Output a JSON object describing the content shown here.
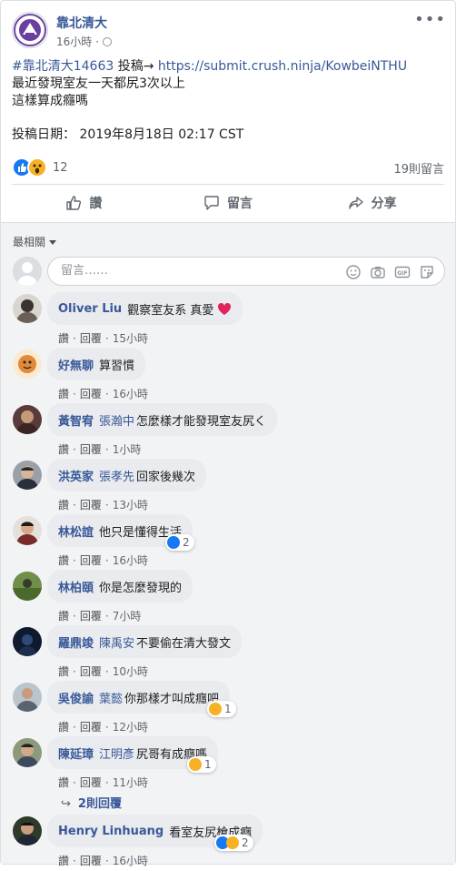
{
  "post": {
    "page_name": "靠北清大",
    "time": "16小時",
    "hashtag": "#靠北清大14663",
    "submit_label": "投稿→",
    "submit_url": "https://submit.crush.ninja/KowbeiNTHU",
    "body_line1": "最近發現室友一天都尻3次以上",
    "body_line2": "這樣算成癮嗎",
    "date_line": "投稿日期： 2019年8月18日 02:17 CST",
    "reaction_count": "12",
    "comment_count": "19則留言"
  },
  "actions": {
    "like": "讚",
    "comment": "留言",
    "share": "分享"
  },
  "comments_section": {
    "sort_label": "最相關",
    "compose_placeholder": "留言……",
    "comments": [
      {
        "author": "Oliver Liu",
        "mention": "",
        "text": "觀察室友系 真愛",
        "time": "15小時"
      },
      {
        "author": "好無聊",
        "mention": "",
        "text": "算習慣",
        "time": "16小時"
      },
      {
        "author": "黃智宥",
        "mention": "張瀚中",
        "text": "怎麼樣才能發現室友尻く",
        "time": "1小時"
      },
      {
        "author": "洪英家",
        "mention": "張孝先",
        "text": "回家後幾次",
        "time": "13小時"
      },
      {
        "author": "林松誼",
        "mention": "",
        "text": "他只是懂得生活",
        "time": "16小時",
        "reactions": "2"
      },
      {
        "author": "林柏頤",
        "mention": "",
        "text": "你是怎麼發現的",
        "time": "7小時"
      },
      {
        "author": "羅鼎竣",
        "mention": "陳禹安",
        "text": "不要偷在清大發文",
        "time": "10小時"
      },
      {
        "author": "吳俊諭",
        "mention": "葉懿",
        "text": "你那樣才叫成癮吧",
        "time": "12小時",
        "reactions": "1"
      },
      {
        "author": "陳延璋",
        "mention": "江明彥",
        "text": "尻哥有成癮嗎",
        "time": "11小時",
        "reactions": "1"
      },
      {
        "author": "Henry Linhuang",
        "mention": "",
        "text": "看室友尻槍成癮",
        "time": "16小時",
        "reactions": "2"
      }
    ],
    "like_label": "讚",
    "reply_label": "回覆",
    "more_replies": "2則回覆"
  },
  "colors": {
    "link": "#385898",
    "like_blue": "#1877f2",
    "wow_yellow": "#f7b125",
    "bubble": "#e9ebee",
    "comments_bg": "#f2f3f5"
  }
}
